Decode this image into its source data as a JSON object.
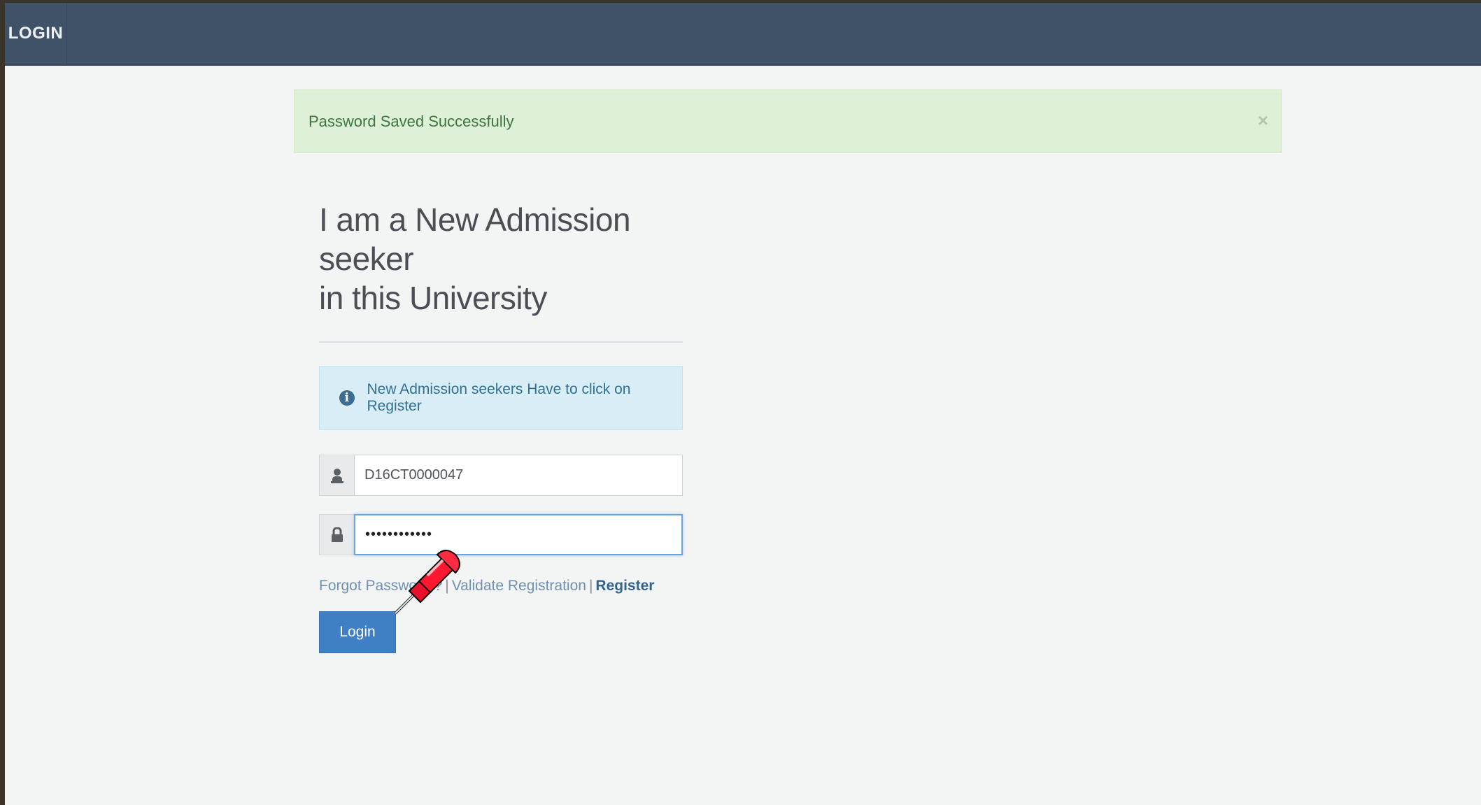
{
  "navbar": {
    "title": "LOGIN"
  },
  "alert_success": {
    "message": "Password Saved Successfully",
    "close_label": "×"
  },
  "login_panel": {
    "heading_line1": "I am a New Admission seeker",
    "heading_line2": "in this University",
    "info_message": "New Admission seekers Have to click on Register",
    "info_icon": "info-icon",
    "username": {
      "icon": "user-icon",
      "value": "D16CT0000047"
    },
    "password": {
      "icon": "lock-icon",
      "value": "••••••••••••"
    },
    "links": {
      "forgot_password": "Forgot Password ?",
      "separator": "|",
      "validate_registration": "Validate Registration",
      "register": "Register"
    },
    "login_button": "Login"
  },
  "cursor": {
    "icon": "pushpin-cursor-icon"
  },
  "colors": {
    "navbar": "#405267",
    "success_bg": "#dff0d8",
    "info_bg": "#d9edf7",
    "primary_button": "#3f7fc6"
  }
}
